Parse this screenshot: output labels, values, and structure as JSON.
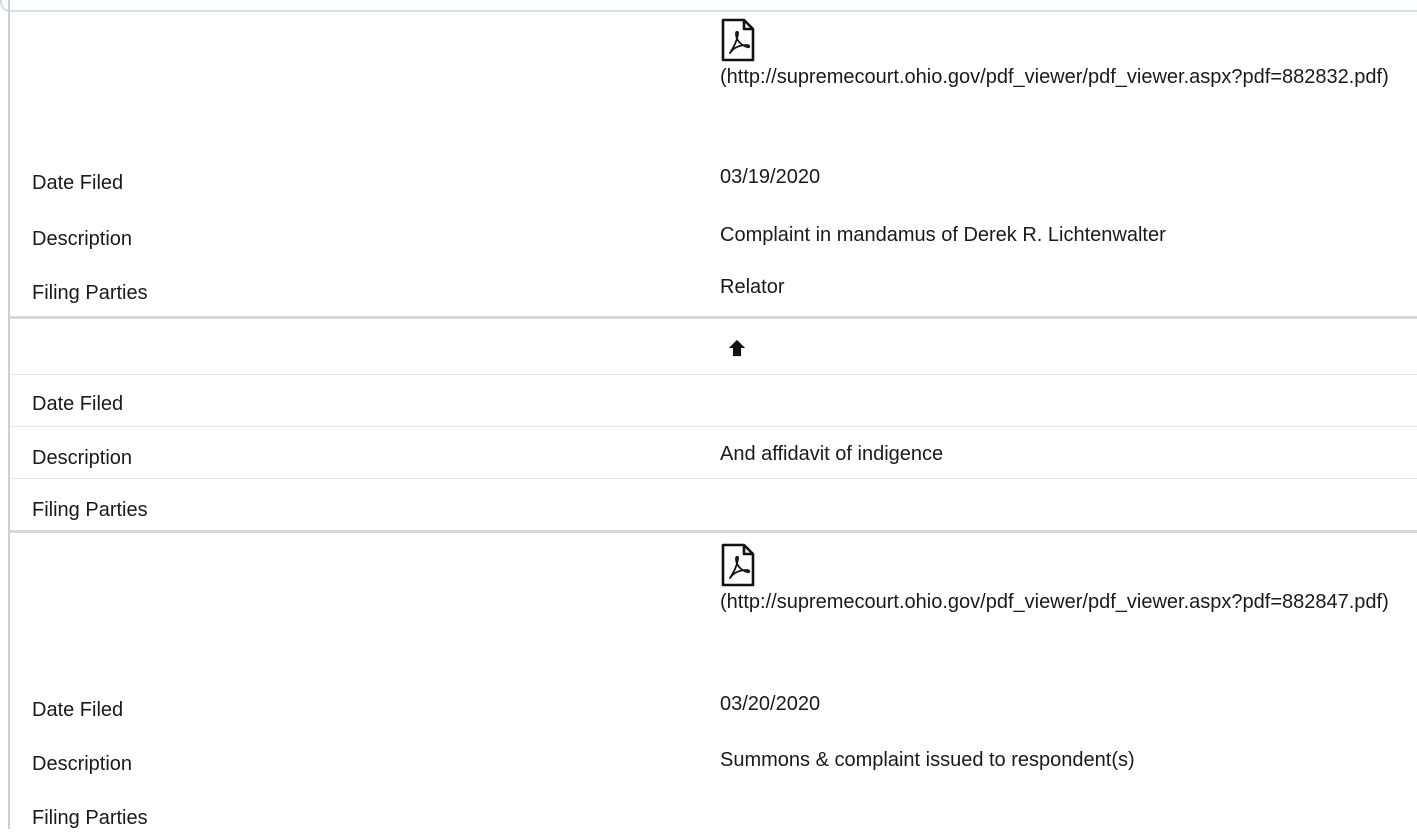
{
  "docket": {
    "entries": [
      {
        "pdf_icon": "pdf-file-icon",
        "pdf_url_text": "(http://supremecourt.ohio.gov/pdf_viewer/pdf_viewer.aspx?pdf=882832.pdf)",
        "date_filed_label": "Date Filed",
        "date_filed": "03/19/2020",
        "description_label": "Description",
        "description": "Complaint in mandamus of Derek R. Lichtenwalter",
        "filing_parties_label": "Filing Parties",
        "filing_parties": "Relator"
      },
      {
        "top_icon": "arrow-up-icon",
        "date_filed_label": "Date Filed",
        "date_filed": "",
        "description_label": "Description",
        "description": "And affidavit of indigence",
        "filing_parties_label": "Filing Parties",
        "filing_parties": ""
      },
      {
        "pdf_icon": "pdf-file-icon",
        "pdf_url_text": "(http://supremecourt.ohio.gov/pdf_viewer/pdf_viewer.aspx?pdf=882847.pdf)",
        "date_filed_label": "Date Filed",
        "date_filed": "03/20/2020",
        "description_label": "Description",
        "description": "Summons & complaint issued to respondent(s)",
        "filing_parties_label": "Filing Parties",
        "filing_parties": ""
      }
    ]
  }
}
